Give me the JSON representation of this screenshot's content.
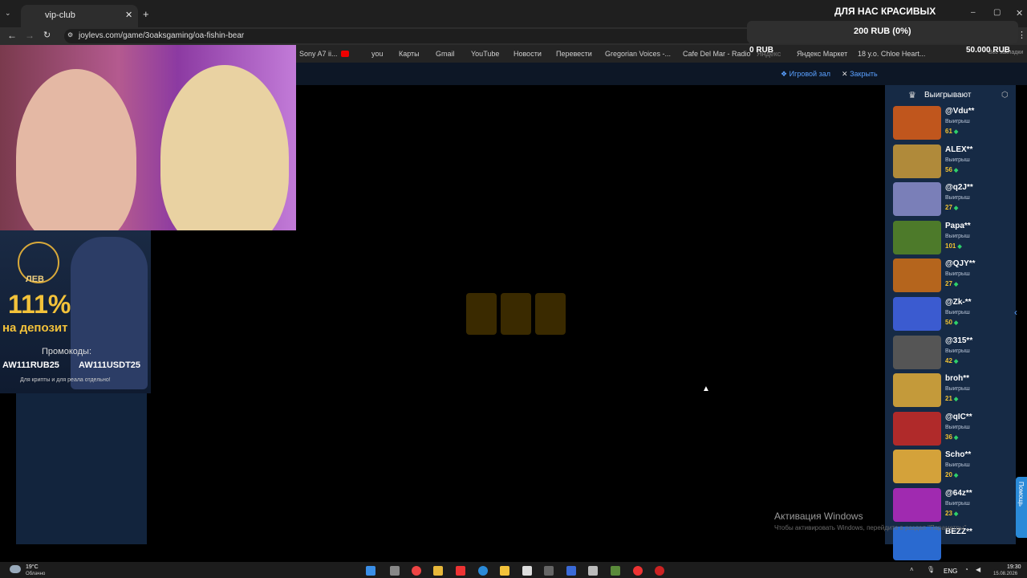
{
  "browser": {
    "tab_title": "vip-club",
    "url": "joylevs.com/game/3oaksgaming/oa-fishin-bear",
    "bookmarks": [
      "Sony A7 ii...",
      "you",
      "Карты",
      "Gmail",
      "YouTube",
      "Новости",
      "Перевести",
      "Gregorian Voices -...",
      "Cafe Del Mar - Radio",
      "Яндекс",
      "Яндекс Маркет",
      "18 y.o. Chloe Heart..."
    ],
    "all_bookmarks": "Все закладки"
  },
  "overlay": {
    "title": "ДЛЯ НАС КРАСИВЫХ",
    "goal": "200 RUB (0%)",
    "left_amount": "0 RUB",
    "right_amount": "50.000 RUB"
  },
  "site": {
    "game_hall": "Игровой зал",
    "close": "Закрыть"
  },
  "promo": {
    "logo": "ЛЕВ",
    "percent": "111%",
    "on_deposit": "на депозит",
    "promocodes_label": "Промокоды:",
    "code1": "AW111RUB25",
    "code2": "AW111USDT25",
    "note": "Для крипты и для реала отдельно!"
  },
  "winners": {
    "title": "Выигрывают",
    "win_label": "Выигрыш",
    "items": [
      {
        "name": "@Vdu**",
        "amount": "61",
        "color": "#c0561d"
      },
      {
        "name": "ALEX**",
        "amount": "56",
        "color": "#b08a3a"
      },
      {
        "name": "@q2J**",
        "amount": "27",
        "color": "#7a7fb8"
      },
      {
        "name": "Papa**",
        "amount": "101",
        "color": "#4d7a2a"
      },
      {
        "name": "@QJY**",
        "amount": "27",
        "color": "#b5651d"
      },
      {
        "name": "@Zk-**",
        "amount": "50",
        "color": "#3b5bd0"
      },
      {
        "name": "@315**",
        "amount": "42",
        "color": "#555555"
      },
      {
        "name": "broh**",
        "amount": "21",
        "color": "#c49a3a"
      },
      {
        "name": "@qIC**",
        "amount": "36",
        "color": "#b02a2a"
      },
      {
        "name": "Scho**",
        "amount": "20",
        "color": "#d4a23a"
      },
      {
        "name": "@64z**",
        "amount": "23",
        "color": "#a02ab0"
      },
      {
        "name": "BEZZ**",
        "amount": "",
        "color": "#2a6ad0"
      }
    ]
  },
  "windows_watermark": {
    "line1": "Активация Windows",
    "line2": "Чтобы активировать Windows, перейдите в раздел \"Параметры\"."
  },
  "taskbar": {
    "temp": "19°C",
    "weather": "Облачно",
    "lang": "ENG",
    "time": "19:30",
    "date": "15.08.2026"
  },
  "help_tab": "Помощь"
}
